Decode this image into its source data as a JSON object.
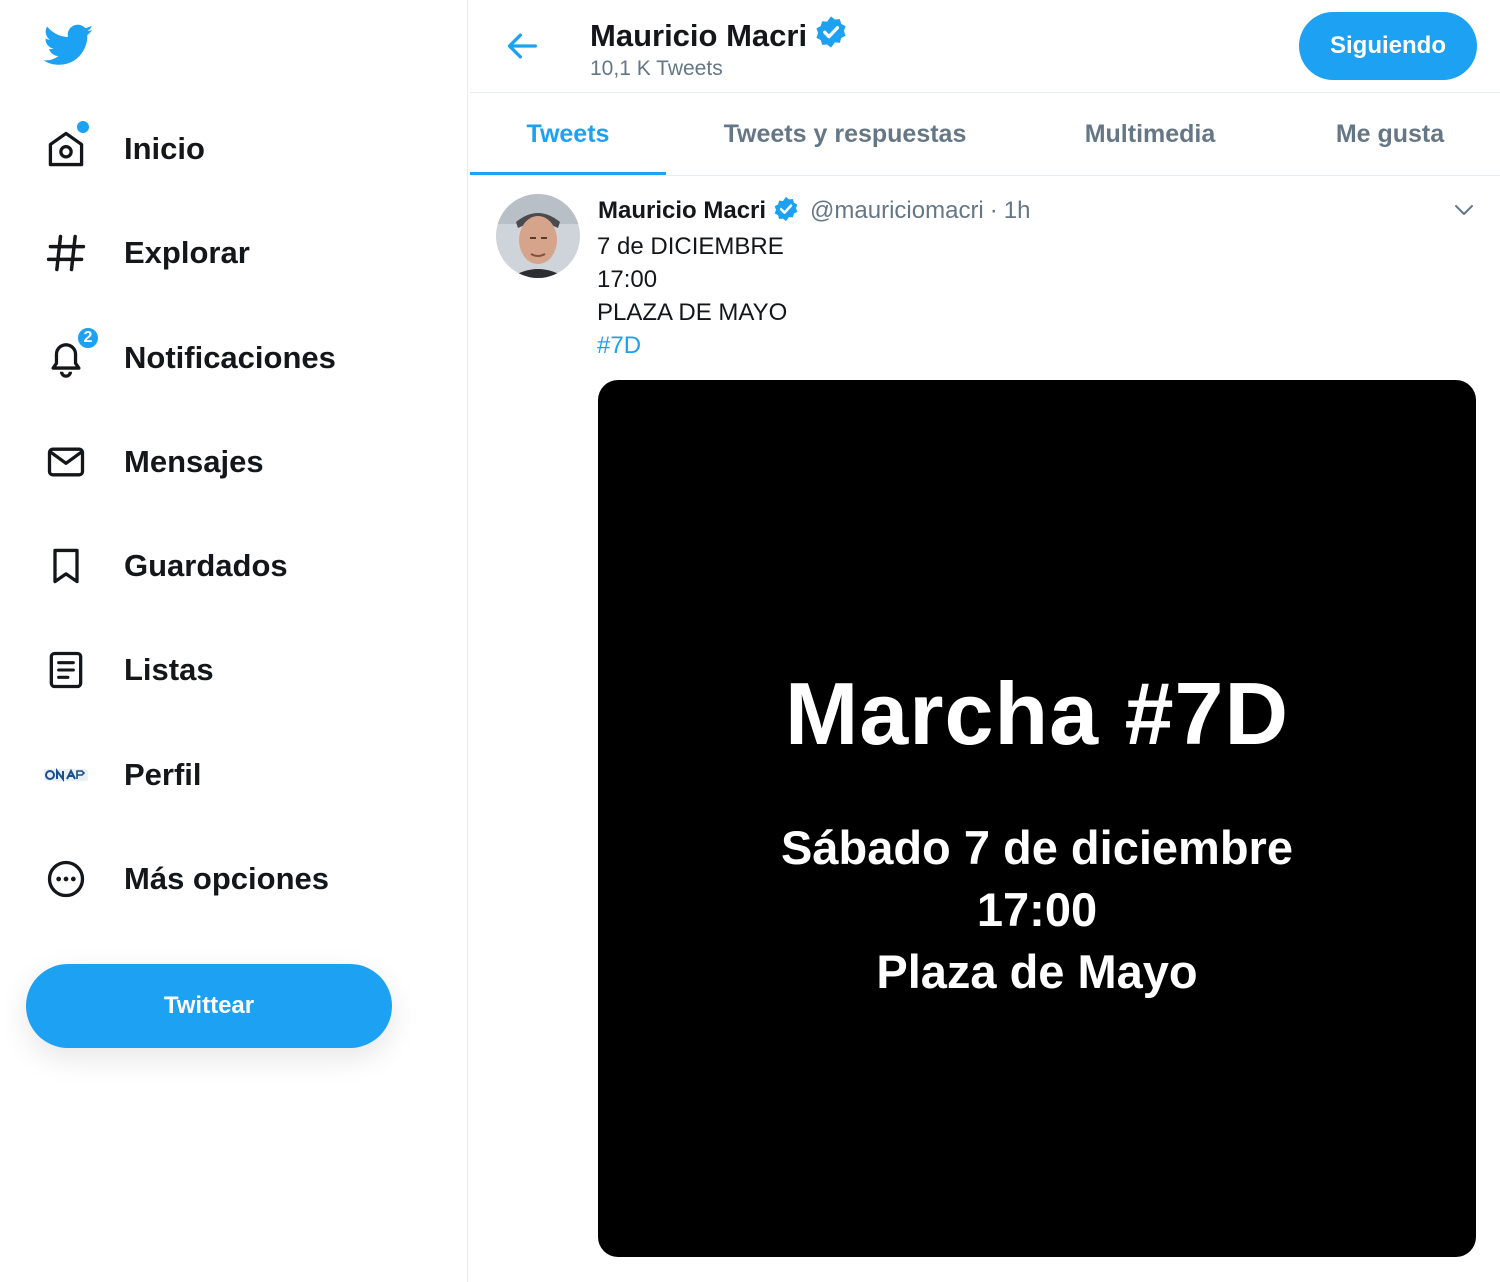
{
  "sidebar": {
    "logo_icon": "twitter-bird-icon",
    "items": [
      {
        "label": "Inicio",
        "icon": "home-icon",
        "has_dot": true
      },
      {
        "label": "Explorar",
        "icon": "hashtag-icon"
      },
      {
        "label": "Notificaciones",
        "icon": "bell-icon",
        "badge": "2"
      },
      {
        "label": "Mensajes",
        "icon": "envelope-icon"
      },
      {
        "label": "Guardados",
        "icon": "bookmark-icon"
      },
      {
        "label": "Listas",
        "icon": "list-icon"
      },
      {
        "label": "Perfil",
        "icon": "profile-logo-icon"
      },
      {
        "label": "Más opciones",
        "icon": "more-options-icon"
      }
    ],
    "tweet_button": "Twittear"
  },
  "header": {
    "back_icon": "back-arrow-icon",
    "name": "Mauricio Macri",
    "verified_icon": "verified-badge-icon",
    "tweet_count": "10,1 K Tweets",
    "follow_button": "Siguiendo"
  },
  "tabs": [
    {
      "label": "Tweets",
      "active": true
    },
    {
      "label": "Tweets y respuestas"
    },
    {
      "label": "Multimedia"
    },
    {
      "label": "Me gusta"
    }
  ],
  "tweet": {
    "author": "Mauricio Macri",
    "handle": "@mauriciomacri",
    "separator": "·",
    "time": "1h",
    "lines": [
      "7 de DICIEMBRE",
      "17:00",
      "PLAZA DE MAYO"
    ],
    "hashtag": "#7D",
    "media": {
      "title": "Marcha #7D",
      "lines": [
        "Sábado 7 de diciembre",
        "17:00",
        "Plaza de Mayo"
      ]
    }
  },
  "colors": {
    "accent": "#1da1f2",
    "text": "#14171a",
    "muted": "#657786"
  }
}
